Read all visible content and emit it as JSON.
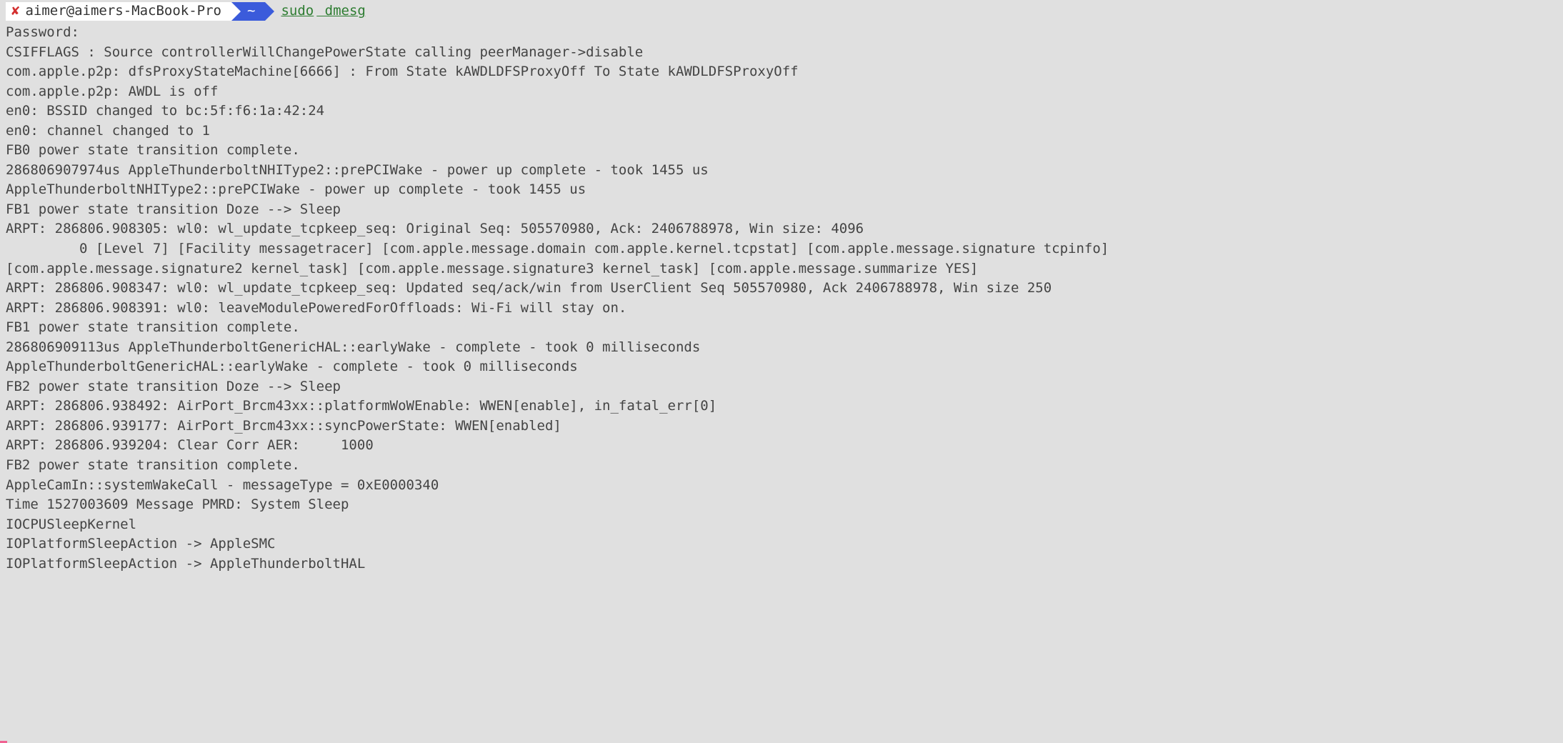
{
  "prompt": {
    "status_glyph": "✘",
    "host": "aimer@aimers-MacBook-Pro",
    "path": "~",
    "command_sudo": "sudo",
    "command_rest": " dmesg"
  },
  "output": [
    {
      "text": "Password:"
    },
    {
      "text": "CSIFFLAGS : Source controllerWillChangePowerState calling peerManager->disable"
    },
    {
      "text": "com.apple.p2p: dfsProxyStateMachine[6666] : From State kAWDLDFSProxyOff To State kAWDLDFSProxyOff"
    },
    {
      "text": "com.apple.p2p: AWDL is off"
    },
    {
      "text": "en0: BSSID changed to bc:5f:f6:1a:42:24"
    },
    {
      "text": "en0: channel changed to 1"
    },
    {
      "text": "FB0 power state transition complete."
    },
    {
      "text": "286806907974us AppleThunderboltNHIType2::prePCIWake - power up complete - took 1455 us"
    },
    {
      "text": "AppleThunderboltNHIType2::prePCIWake - power up complete - took 1455 us"
    },
    {
      "text": "FB1 power state transition Doze --> Sleep"
    },
    {
      "text": "ARPT: 286806.908305: wl0: wl_update_tcpkeep_seq: Original Seq: 505570980, Ack: 2406788978, Win size: 4096"
    },
    {
      "indent": true,
      "text": "0 [Level 7] [Facility messagetracer] [com.apple.message.domain com.apple.kernel.tcpstat] [com.apple.message.signature tcpinfo]"
    },
    {
      "text": "[com.apple.message.signature2 kernel_task] [com.apple.message.signature3 kernel_task] [com.apple.message.summarize YES]"
    },
    {
      "text": "ARPT: 286806.908347: wl0: wl_update_tcpkeep_seq: Updated seq/ack/win from UserClient Seq 505570980, Ack 2406788978, Win size 250"
    },
    {
      "text": "ARPT: 286806.908391: wl0: leaveModulePoweredForOffloads: Wi-Fi will stay on."
    },
    {
      "text": "FB1 power state transition complete."
    },
    {
      "text": "286806909113us AppleThunderboltGenericHAL::earlyWake - complete - took 0 milliseconds"
    },
    {
      "text": "AppleThunderboltGenericHAL::earlyWake - complete - took 0 milliseconds"
    },
    {
      "text": "FB2 power state transition Doze --> Sleep"
    },
    {
      "text": "ARPT: 286806.938492: AirPort_Brcm43xx::platformWoWEnable: WWEN[enable], in_fatal_err[0]"
    },
    {
      "text": "ARPT: 286806.939177: AirPort_Brcm43xx::syncPowerState: WWEN[enabled]"
    },
    {
      "text": "ARPT: 286806.939204: Clear Corr AER:     1000"
    },
    {
      "text": "FB2 power state transition complete."
    },
    {
      "text": "AppleCamIn::systemWakeCall - messageType = 0xE0000340"
    },
    {
      "text": "Time 1527003609 Message PMRD: System Sleep"
    },
    {
      "text": "IOCPUSleepKernel"
    },
    {
      "text": "IOPlatformSleepAction -> AppleSMC"
    },
    {
      "text": "IOPlatformSleepAction -> AppleThunderboltHAL"
    }
  ]
}
